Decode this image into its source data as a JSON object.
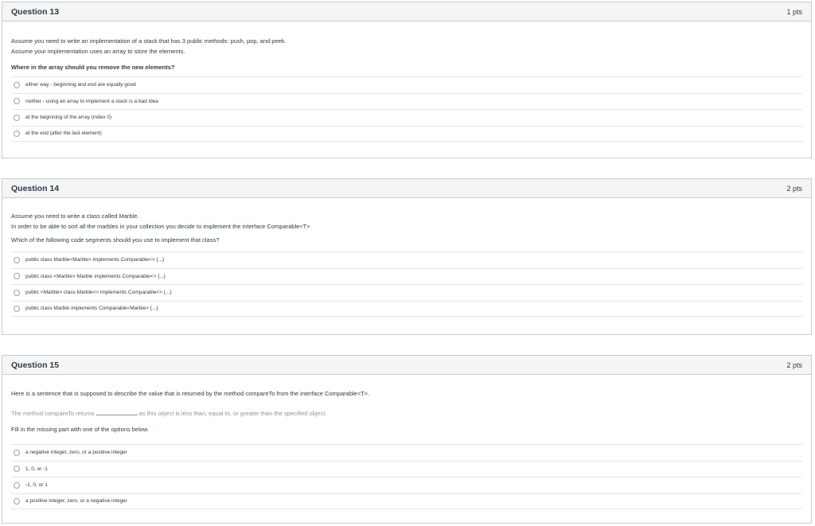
{
  "questions": [
    {
      "title": "Question 13",
      "points": "1 pts",
      "lines": [
        "Assume you need to write an implementation of a stack that has 3 public methods: push, pop, and peek.",
        "Assume your implementation uses an array to store the elements."
      ],
      "prompt": "Where in the array should you remove the new elements?",
      "answers": [
        "either way - beginning and end are equally good",
        "neither - using an array to implement a stack is a bad idea",
        "at the beginning of the array (index 0)",
        "at the end (after the last element)"
      ]
    },
    {
      "title": "Question 14",
      "points": "2 pts",
      "lines": [
        "Assume you need to write a class called Marble.",
        "In order to be able to sort all the marbles in your collection you decide to implement the interface Comparable<T>"
      ],
      "prompt": "Which of the following code segments should you use to implement that class?",
      "answers": [
        "public class Marble<Marble> implements Comparable<> {...}",
        "public class <Marble> Marble implements Comparable<> {...}",
        "public <Marble> class Marble<> implements Comparable<> {...}",
        "public class Marble implements Comparable<Marble> {...}"
      ]
    },
    {
      "title": "Question 15",
      "points": "2 pts",
      "lines": [
        "Here is a sentence that is supposed to describe the value that is returned by the method compareTo from the interface Comparable<T>."
      ],
      "sentence_before": "The method compareTo returns",
      "sentence_after": "as this object is less than, equal to, or greater than the specified object.",
      "prompt": "Fill in the missing part with one of the options below.",
      "answers": [
        "a negative integer, zero, or a positive integer",
        "1, 0, or -1",
        "-1, 0, or 1",
        "a positive integer, zero, or a negative integer"
      ]
    }
  ]
}
